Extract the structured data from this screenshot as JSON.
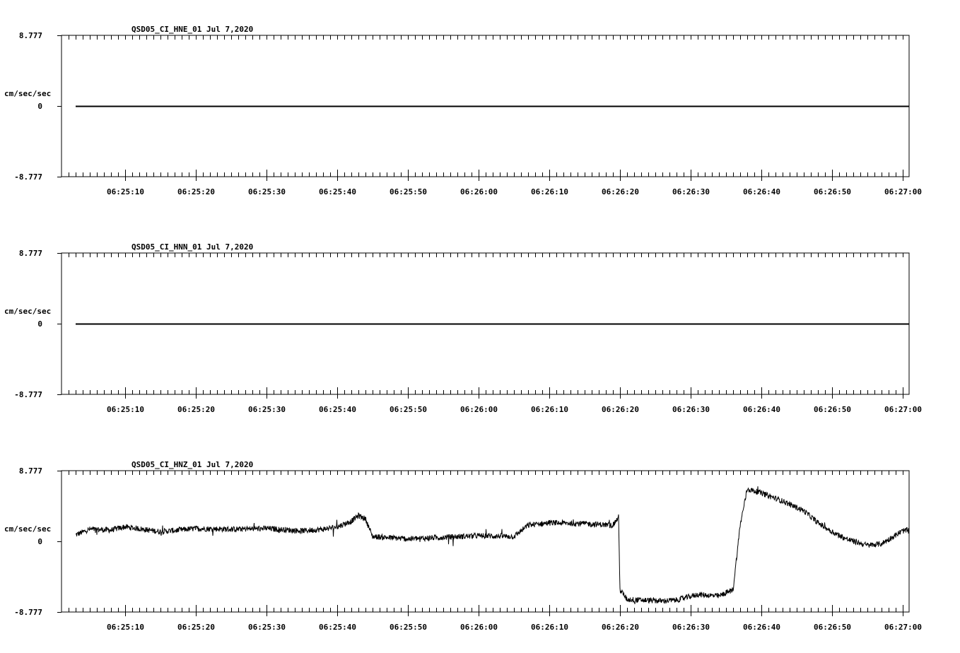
{
  "chart_data": [
    {
      "type": "line",
      "title": "QSD05_CI_HNE_01  Jul 7,2020",
      "ylabel": "cm/sec/sec",
      "ylim": [
        -8.777,
        8.777
      ],
      "yticks": [
        "8.777",
        "0",
        "-8.777"
      ],
      "xlim": [
        "06:25:01",
        "06:27:01"
      ],
      "xticks": [
        "06:25:10",
        "06:25:20",
        "06:25:30",
        "06:25:40",
        "06:25:50",
        "06:26:00",
        "06:26:10",
        "06:26:20",
        "06:26:30",
        "06:26:40",
        "06:26:50",
        "06:27:00"
      ],
      "series": [
        {
          "x": [
            "06:25:03",
            "06:27:01"
          ],
          "y": [
            0,
            0
          ],
          "noise": 0
        }
      ]
    },
    {
      "type": "line",
      "title": "QSD05_CI_HNN_01  Jul 7,2020",
      "ylabel": "cm/sec/sec",
      "ylim": [
        -8.777,
        8.777
      ],
      "yticks": [
        "8.777",
        "0",
        "-8.777"
      ],
      "xlim": [
        "06:25:01",
        "06:27:01"
      ],
      "xticks": [
        "06:25:10",
        "06:25:20",
        "06:25:30",
        "06:25:40",
        "06:25:50",
        "06:26:00",
        "06:26:10",
        "06:26:20",
        "06:26:30",
        "06:26:40",
        "06:26:50",
        "06:27:00"
      ],
      "series": [
        {
          "x": [
            "06:25:03",
            "06:27:01"
          ],
          "y": [
            0,
            0
          ],
          "noise": 0
        }
      ]
    },
    {
      "type": "line",
      "title": "QSD05_CI_HNZ_01  Jul 7,2020",
      "ylabel": "cm/sec/sec",
      "ylim": [
        -8.777,
        8.777
      ],
      "yticks": [
        "8.777",
        "0",
        "-8.777"
      ],
      "xlim": [
        "06:25:01",
        "06:27:01"
      ],
      "xticks": [
        "06:25:10",
        "06:25:20",
        "06:25:30",
        "06:25:40",
        "06:25:50",
        "06:26:00",
        "06:26:10",
        "06:26:20",
        "06:26:30",
        "06:26:40",
        "06:26:50",
        "06:27:00"
      ],
      "series": [
        {
          "noise": 0.35,
          "x": [
            "06:25:03",
            "06:25:05",
            "06:25:08",
            "06:25:10",
            "06:25:15",
            "06:25:20",
            "06:25:25",
            "06:25:30",
            "06:25:35",
            "06:25:38",
            "06:25:40",
            "06:25:42",
            "06:25:43",
            "06:25:44",
            "06:25:45",
            "06:25:50",
            "06:26:00",
            "06:26:05",
            "06:26:07",
            "06:26:10",
            "06:26:15",
            "06:26:19",
            "06:26:19.8",
            "06:26:20",
            "06:26:21",
            "06:26:23",
            "06:26:26",
            "06:26:28",
            "06:26:31",
            "06:26:34",
            "06:26:36",
            "06:26:37",
            "06:26:38",
            "06:26:40",
            "06:26:43",
            "06:26:46",
            "06:26:48",
            "06:26:50",
            "06:26:52",
            "06:26:55",
            "06:26:57",
            "06:27:00",
            "06:27:01"
          ],
          "y": [
            0.8,
            1.5,
            1.4,
            1.8,
            1.2,
            1.6,
            1.5,
            1.6,
            1.3,
            1.5,
            1.8,
            2.5,
            3.2,
            2.8,
            0.6,
            0.3,
            0.7,
            0.6,
            2.0,
            2.3,
            2.2,
            2.0,
            3.0,
            -6.0,
            -7.2,
            -7.3,
            -7.4,
            -7.3,
            -6.6,
            -6.8,
            -6.0,
            2.0,
            6.5,
            6.0,
            5.0,
            3.8,
            2.3,
            1.2,
            0.3,
            -0.5,
            -0.3,
            1.3,
            1.4
          ]
        }
      ]
    }
  ]
}
